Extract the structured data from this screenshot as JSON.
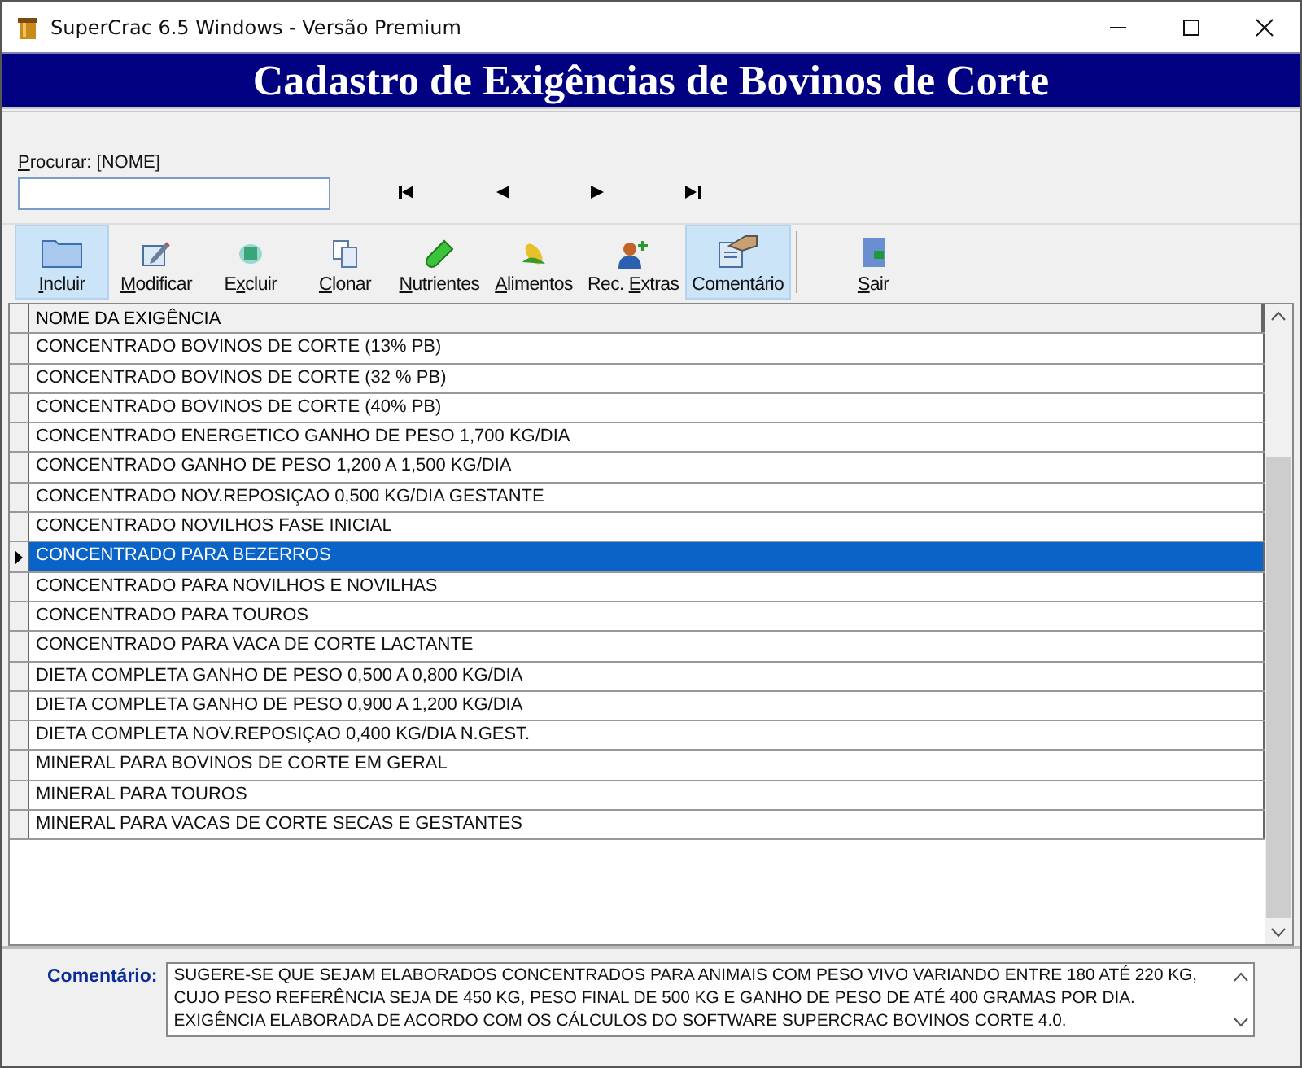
{
  "window": {
    "title": "SuperCrac 6.5 Windows - Versão Premium"
  },
  "banner": "Cadastro de Exigências de Bovinos de Corte",
  "search": {
    "label": "Procurar: [NOME]"
  },
  "toolbar": [
    {
      "label": "Incluir",
      "highlighted": true
    },
    {
      "label": "Modificar",
      "highlighted": false
    },
    {
      "label": "Excluir",
      "highlighted": false
    },
    {
      "label": "Clonar",
      "highlighted": false
    },
    {
      "label": "Nutrientes",
      "highlighted": false
    },
    {
      "label": "Alimentos",
      "highlighted": false
    },
    {
      "label": "Rec. Extras",
      "highlighted": false
    },
    {
      "label": "Comentário",
      "highlighted": true
    },
    {
      "label": "Sair",
      "highlighted": false
    }
  ],
  "table": {
    "columns": [
      "NOME DA EXIGÊNCIA"
    ],
    "rows": [
      {
        "name": "CONCENTRADO BOVINOS DE CORTE (13% PB)",
        "selected": false
      },
      {
        "name": "CONCENTRADO BOVINOS DE CORTE (32 % PB)",
        "selected": false
      },
      {
        "name": "CONCENTRADO BOVINOS DE CORTE (40% PB)",
        "selected": false
      },
      {
        "name": "CONCENTRADO ENERGETICO GANHO DE PESO 1,700 KG/DIA",
        "selected": false
      },
      {
        "name": "CONCENTRADO GANHO DE PESO 1,200 A 1,500 KG/DIA",
        "selected": false
      },
      {
        "name": "CONCENTRADO NOV.REPOSIÇAO 0,500 KG/DIA GESTANTE",
        "selected": false
      },
      {
        "name": "CONCENTRADO NOVILHOS FASE INICIAL",
        "selected": false
      },
      {
        "name": "CONCENTRADO PARA BEZERROS",
        "selected": true
      },
      {
        "name": "CONCENTRADO PARA NOVILHOS E NOVILHAS",
        "selected": false
      },
      {
        "name": "CONCENTRADO PARA TOUROS",
        "selected": false
      },
      {
        "name": "CONCENTRADO PARA VACA DE CORTE LACTANTE",
        "selected": false
      },
      {
        "name": "DIETA COMPLETA GANHO DE PESO 0,500 A 0,800 KG/DIA",
        "selected": false
      },
      {
        "name": "DIETA COMPLETA GANHO DE PESO 0,900 A 1,200 KG/DIA",
        "selected": false
      },
      {
        "name": "DIETA COMPLETA NOV.REPOSIÇAO 0,400 KG/DIA N.GEST.",
        "selected": false
      },
      {
        "name": "MINERAL PARA BOVINOS DE CORTE EM GERAL",
        "selected": false
      },
      {
        "name": "MINERAL PARA TOUROS",
        "selected": false
      },
      {
        "name": "MINERAL PARA VACAS DE CORTE SECAS E GESTANTES",
        "selected": false
      }
    ]
  },
  "comment": {
    "label": "Comentário:",
    "text": "SUGERE-SE QUE SEJAM ELABORADOS CONCENTRADOS PARA ANIMAIS COM PESO VIVO VARIANDO ENTRE 180 ATÉ 220 KG, CUJO PESO REFERÊNCIA SEJA DE 450 KG, PESO FINAL DE 500 KG E GANHO DE PESO DE ATÉ 400 GRAMAS POR DIA. EXIGÊNCIA ELABORADA DE ACORDO COM OS CÁLCULOS DO SOFTWARE SUPERCRAC BOVINOS CORTE 4.0."
  }
}
